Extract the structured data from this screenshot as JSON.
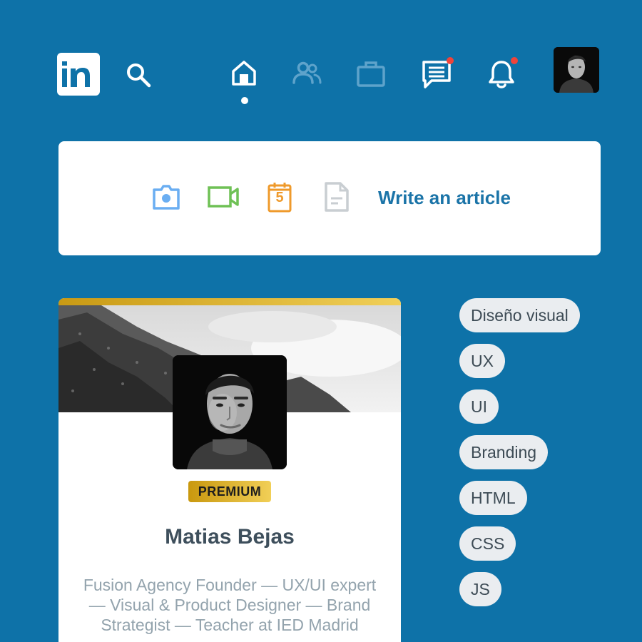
{
  "nav": {
    "logo_text": "in",
    "icons": [
      "linkedin-logo",
      "search-icon",
      "home-icon",
      "network-icon",
      "jobs-icon",
      "messaging-icon",
      "notifications-icon"
    ],
    "active": "home",
    "badge_color": "#f0443a",
    "icon_colors": {
      "active": "#ffffff",
      "inactive": "#5ea3cb"
    }
  },
  "composer": {
    "icons": [
      "camera-icon",
      "video-icon",
      "event-icon",
      "document-icon"
    ],
    "event_day": "5",
    "write_article_label": "Write an article",
    "colors": {
      "camera": "#6aaef2",
      "video": "#6fc155",
      "event": "#ef9a2b",
      "document": "#c9ced2",
      "link": "#1b74a8"
    }
  },
  "profile": {
    "badge": "PREMIUM",
    "name": "Matias Bejas",
    "headline": "Fusion Agency Founder — UX/UI expert — Visual & Product Designer — Brand Strategist — Teacher at IED Madrid"
  },
  "skills": [
    "Diseño visual",
    "UX",
    "UI",
    "Branding",
    "HTML",
    "CSS",
    "JS"
  ],
  "theme": {
    "background": "#0e72a8",
    "premium_gold": "#d8ad2b"
  }
}
